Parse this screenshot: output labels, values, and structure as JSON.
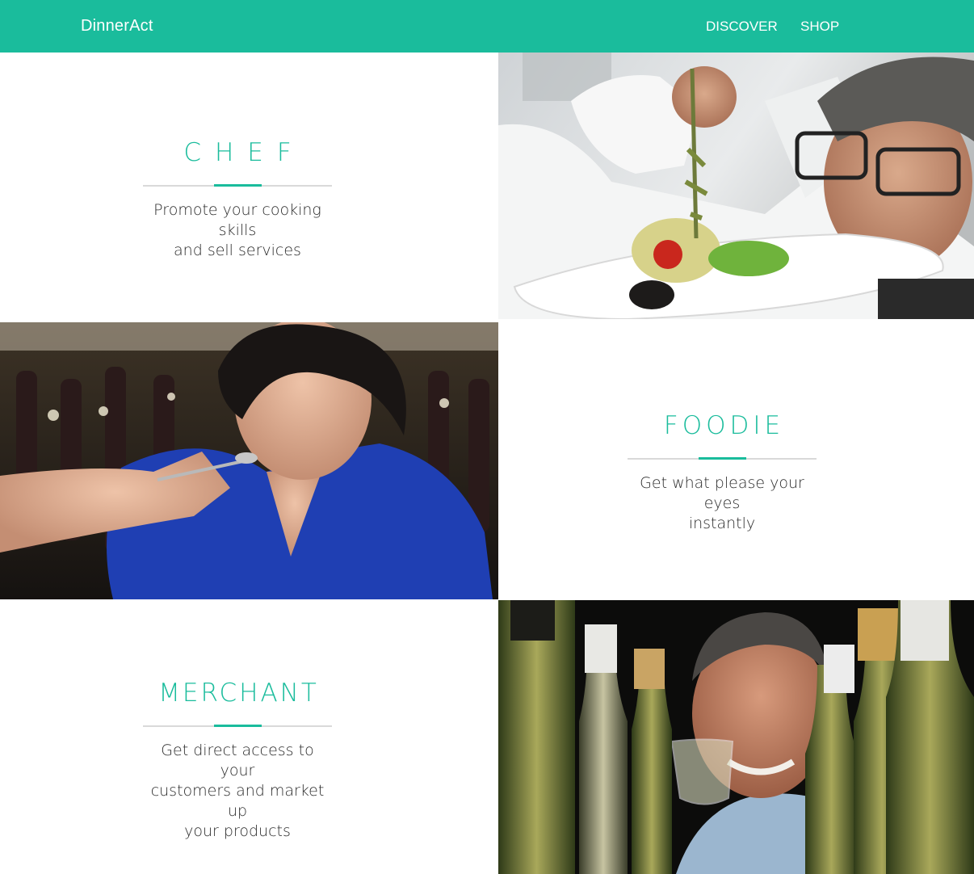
{
  "header": {
    "brand": "DinnerAct",
    "nav": [
      {
        "label": "DISCOVER"
      },
      {
        "label": "SHOP"
      }
    ]
  },
  "colors": {
    "accent": "#1abc9c",
    "text": "#2b2b2b",
    "divider": "#d9d9d9"
  },
  "roles": [
    {
      "title": "CHEF",
      "description_lines": [
        "Promote your cooking skills",
        "and sell services"
      ],
      "photo": "chef-plating-dish-photo"
    },
    {
      "title": "FOODIE",
      "description_lines": [
        "Get what please your eyes",
        "instantly"
      ],
      "photo": "woman-tasting-food-photo"
    },
    {
      "title": "MERCHANT",
      "description_lines": [
        "Get direct access to your",
        "customers and market up",
        "your products"
      ],
      "photo": "wine-merchant-with-bottles-photo"
    }
  ]
}
